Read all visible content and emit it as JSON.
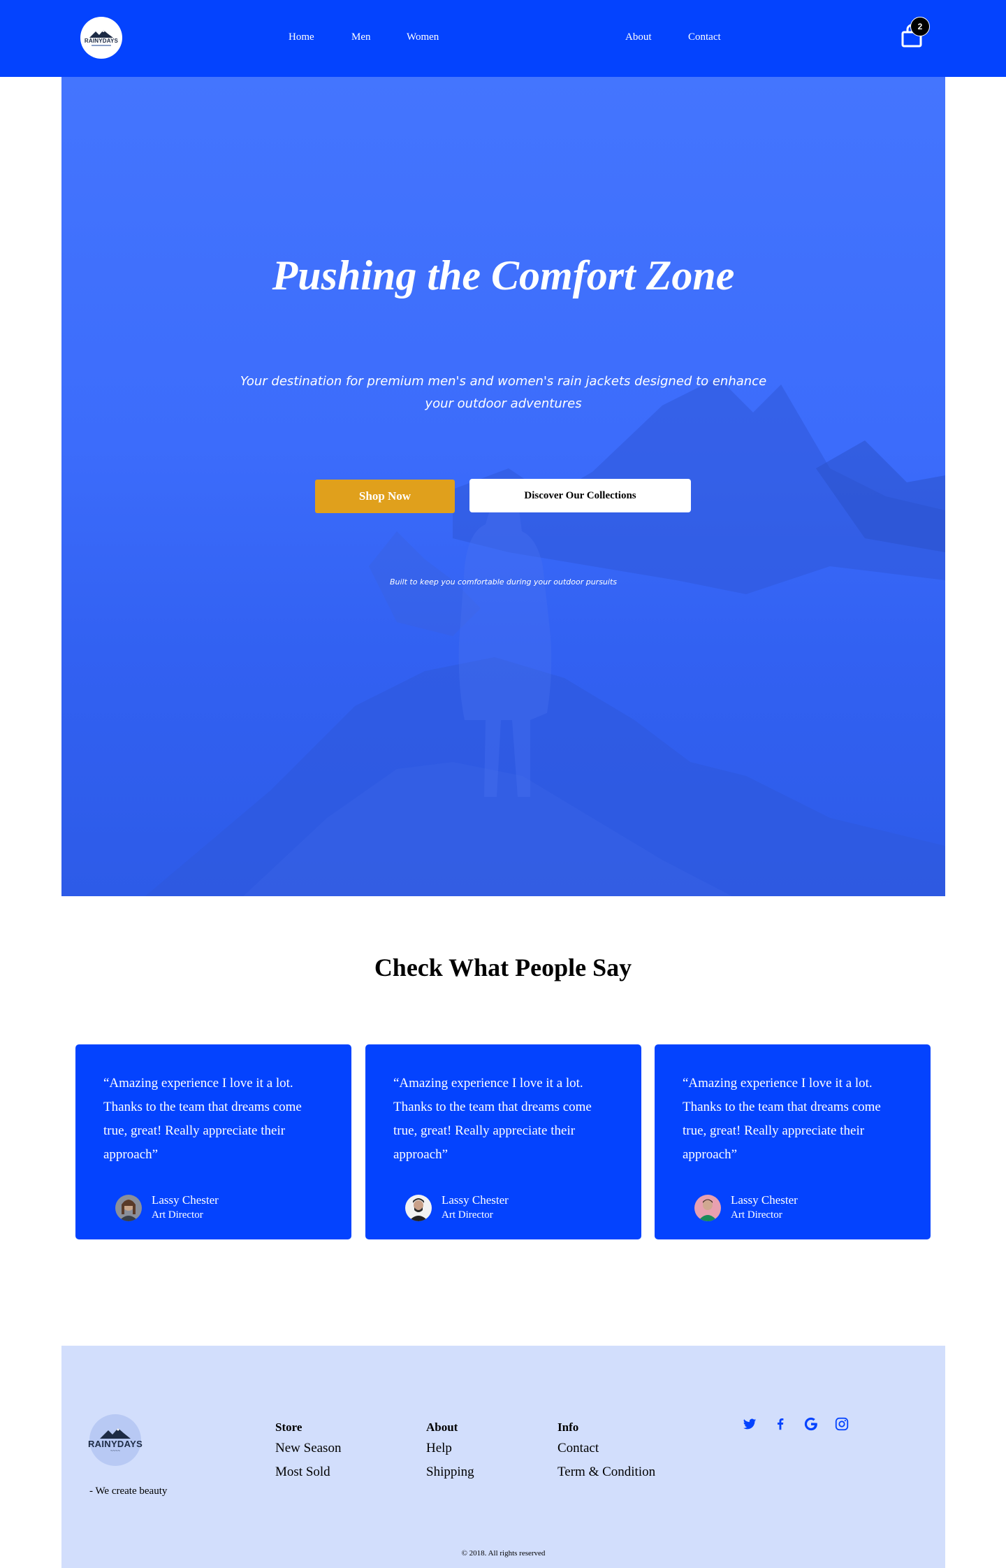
{
  "brand": {
    "logo_text": "RAINYDAYS"
  },
  "nav": {
    "links": [
      "Home",
      "Men",
      "Women",
      "About",
      "Contact"
    ],
    "cart_count": "2"
  },
  "hero": {
    "title": "Pushing the Comfort Zone",
    "subtitle": "Your destination for premium men's and women's rain jackets designed to enhance your outdoor adventures",
    "primary_button": "Shop Now",
    "secondary_button": "Discover Our Collections",
    "note": "Built to keep you comfortable during your outdoor pursuits"
  },
  "testimonials": {
    "title": "Check What People Say",
    "cards": [
      {
        "quote": "“Amazing experience I love it a lot. Thanks to the team that dreams come true, great! Really appreciate their approach”",
        "name": "Lassy Chester",
        "role": "Art Director"
      },
      {
        "quote": "“Amazing experience I love it a lot. Thanks to the team that dreams come true, great! Really appreciate their approach”",
        "name": "Lassy Chester",
        "role": "Art Director"
      },
      {
        "quote": "“Amazing experience I love it a lot. Thanks to the team that dreams come true, great! Really appreciate their approach”",
        "name": "Lassy Chester",
        "role": "Art Director"
      }
    ]
  },
  "footer": {
    "tagline": "- We create beauty",
    "columns": [
      {
        "heading": "Store",
        "links": [
          "New Season",
          "Most Sold"
        ]
      },
      {
        "heading": "About",
        "links": [
          "Help",
          "Shipping"
        ]
      },
      {
        "heading": "Info",
        "links": [
          "Contact",
          "Term & Condition"
        ]
      }
    ],
    "social": [
      "twitter-icon",
      "facebook-icon",
      "google-icon",
      "instagram-icon"
    ],
    "copyright": "© 2018. All rights reserved"
  },
  "colors": {
    "primary": "#0443fe",
    "accent": "#e0a01c",
    "footer_bg": "#d2defc"
  }
}
